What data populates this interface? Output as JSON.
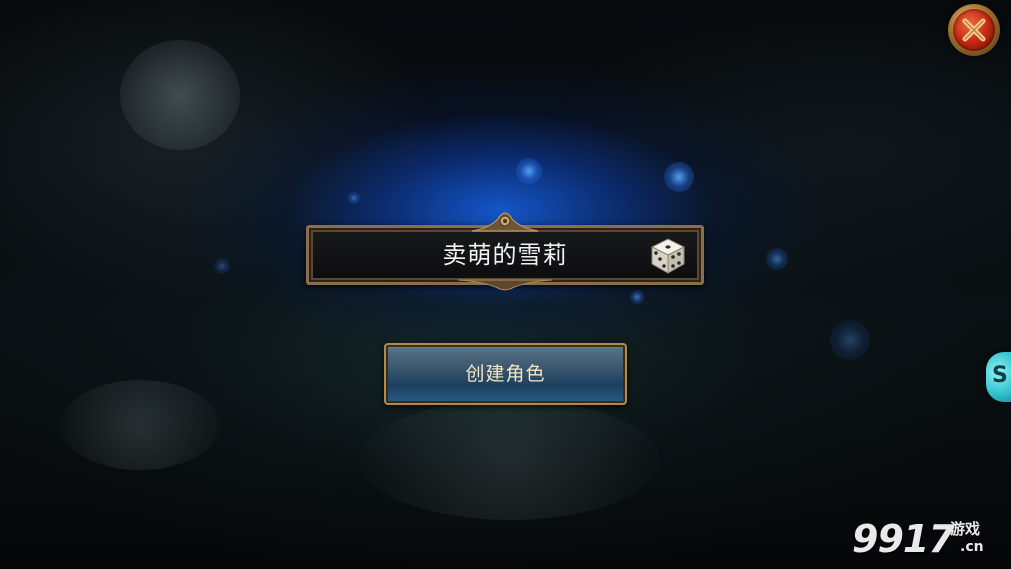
{
  "character": {
    "name": "卖萌的雪莉"
  },
  "actions": {
    "create_label": "创建角色"
  },
  "side_tab": {
    "glyph": "S"
  },
  "watermark": {
    "number": "9917",
    "cn": "游戏",
    "domain": ".cn"
  },
  "colors": {
    "glow": "#1a5bd6",
    "frame_gold": "#8a6f4c",
    "button_blue": "#2b5c86",
    "close_red": "#c32812",
    "side_tab_cyan": "#2fc1cc"
  },
  "icons": {
    "close": "close-icon",
    "dice": "dice-icon",
    "ornament": "ornament-icon"
  }
}
